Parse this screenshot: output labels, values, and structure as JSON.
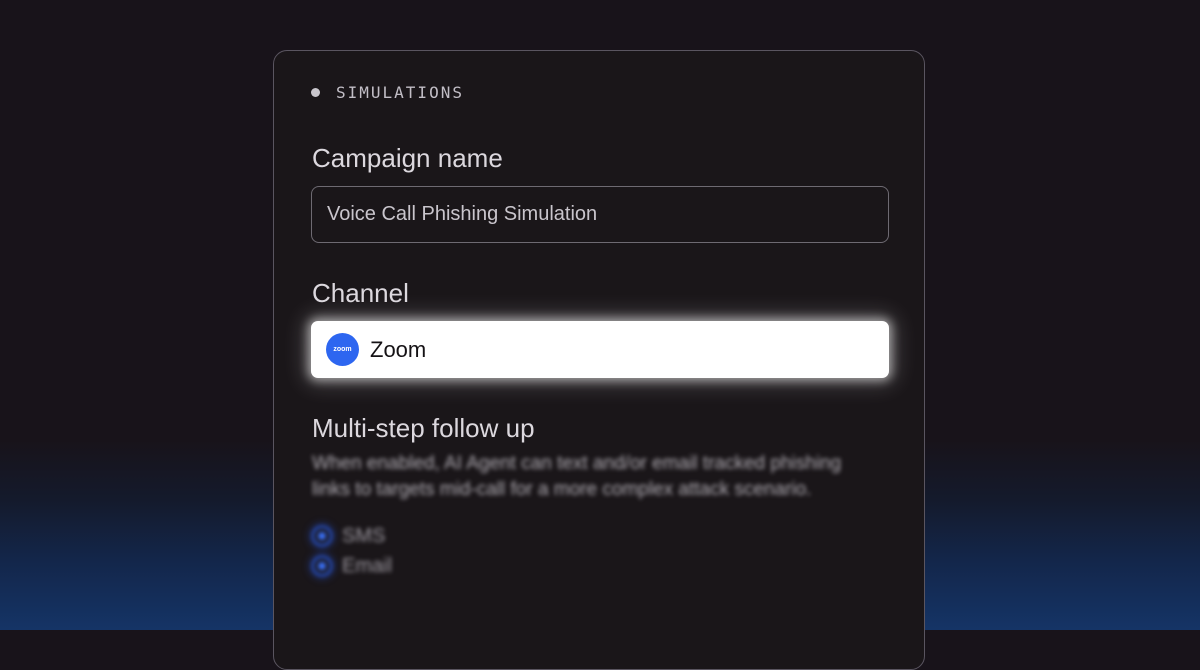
{
  "section": {
    "label": "SIMULATIONS"
  },
  "campaign": {
    "label": "Campaign name",
    "value": "Voice Call Phishing Simulation"
  },
  "channel": {
    "label": "Channel",
    "selected": "Zoom",
    "icon": "zoom-logo-icon",
    "icon_text": "zoom",
    "icon_color": "#2d66f0"
  },
  "followup": {
    "label": "Multi-step follow up",
    "description": "When enabled, AI Agent can text and/or email tracked phishing links to targets mid-call for a more complex attack scenario.",
    "options": [
      {
        "label": "SMS",
        "selected": true
      },
      {
        "label": "Email",
        "selected": true
      }
    ]
  },
  "colors": {
    "accent": "#3a72ff",
    "background": "#18131a"
  }
}
